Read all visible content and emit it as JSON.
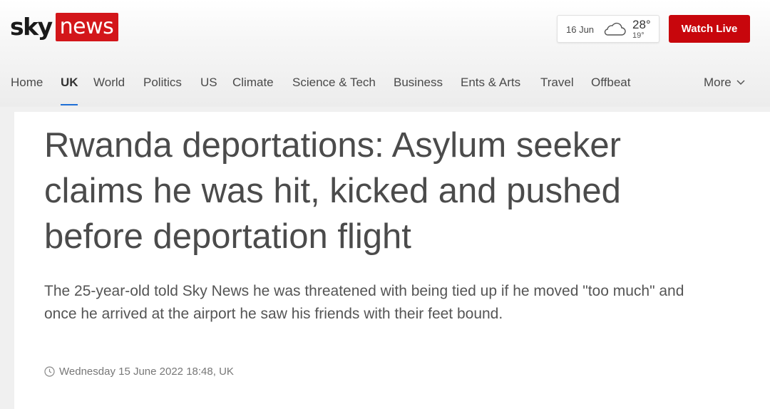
{
  "brand": {
    "sky": "sky",
    "news": "news"
  },
  "weather": {
    "date": "16 Jun",
    "high": "28°",
    "low": "19°",
    "icon": "cloud-icon"
  },
  "watch_live": "Watch Live",
  "nav": {
    "items": [
      "Home",
      "UK",
      "World",
      "Politics",
      "US",
      "Climate",
      "Science & Tech",
      "Business",
      "Ents & Arts",
      "Travel",
      "Offbeat"
    ],
    "active": "UK",
    "more": "More"
  },
  "article": {
    "headline": "Rwanda deportations: Asylum seeker claims he was hit, kicked and pushed before deportation flight",
    "standfirst": "The 25-year-old told Sky News he was threatened with being tied up if he moved \"too much\" and once he arrived at the airport he saw his friends with their feet bound.",
    "timestamp": "Wednesday 15 June 2022 18:48, UK"
  },
  "colors": {
    "brand_red": "#d3161a",
    "watch_live_red": "#c8060c",
    "active_underline": "#1f6fd6"
  }
}
